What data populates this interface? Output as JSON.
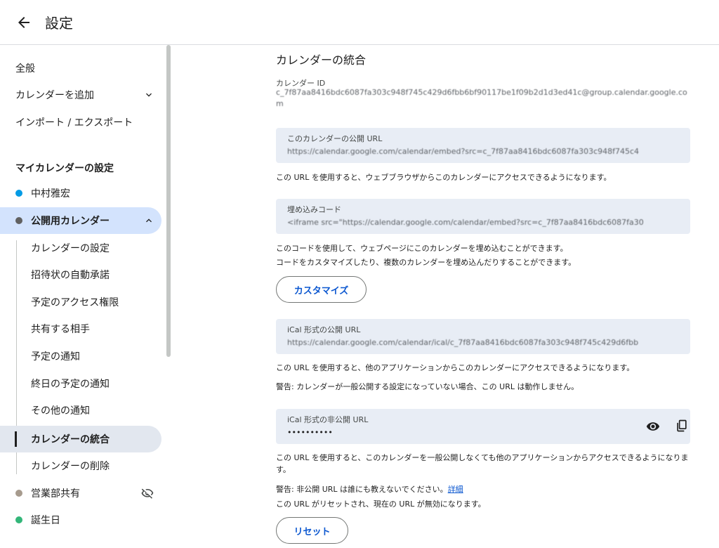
{
  "header": {
    "title": "設定"
  },
  "sidebar": {
    "general": "全般",
    "add_calendar": "カレンダーを追加",
    "import_export": "インポート / エクスポート",
    "my_calendars_header": "マイカレンダーの設定",
    "calendars": [
      {
        "name": "中村雅宏",
        "color": "#039be5"
      },
      {
        "name": "公開用カレンダー",
        "color": "#616161"
      }
    ],
    "subitems": [
      "カレンダーの設定",
      "招待状の自動承諾",
      "予定のアクセス権限",
      "共有する相手",
      "予定の通知",
      "終日の予定の通知",
      "その他の通知",
      "カレンダーの統合",
      "カレンダーの削除"
    ],
    "other_calendars": [
      {
        "name": "営業部共有",
        "color": "#a79b8e"
      },
      {
        "name": "誕生日",
        "color": "#33b679"
      }
    ]
  },
  "integration": {
    "heading": "カレンダーの統合",
    "calendar_id_label": "カレンダー ID",
    "calendar_id_value": "c_7f87aa8416bdc6087fa303c948f745c429d6fbb6bf90117be1f09b2d1d3ed41c@group.calendar.google.com",
    "public_url_label": "このカレンダーの公開 URL",
    "public_url_value": "https://calendar.google.com/calendar/embed?src=c_7f87aa8416bdc6087fa303c948f745c4",
    "public_url_desc": "この URL を使用すると、ウェブブラウザからこのカレンダーにアクセスできるようになります。",
    "embed_label": "埋め込みコード",
    "embed_value": "<iframe src=\"https://calendar.google.com/calendar/embed?src=c_7f87aa8416bdc6087fa30",
    "embed_desc1": "このコードを使用して、ウェブページにこのカレンダーを埋め込むことができます。",
    "embed_desc2": "コードをカスタマイズしたり、複数のカレンダーを埋め込んだりすることができます。",
    "customize_button": "カスタマイズ",
    "ical_public_label": "iCal 形式の公開 URL",
    "ical_public_value": "https://calendar.google.com/calendar/ical/c_7f87aa8416bdc6087fa303c948f745c429d6fbb",
    "ical_public_desc": "この URL を使用すると、他のアプリケーションからこのカレンダーにアクセスできるようになります。",
    "ical_public_warning": "警告: カレンダーが一般公開する設定になっていない場合、この URL は動作しません。",
    "ical_private_label": "iCal 形式の非公開 URL",
    "ical_private_value": "••••••••••",
    "ical_private_desc": "この URL を使用すると、このカレンダーを一般公開しなくても他のアプリケーションからアクセスできるようになります。",
    "ical_private_warning": "警告: 非公開 URL は誰にも教えないでください。",
    "details_link": "詳細",
    "reset_note": "この URL がリセットされ、現在の URL が無効になります。",
    "reset_button": "リセット"
  }
}
